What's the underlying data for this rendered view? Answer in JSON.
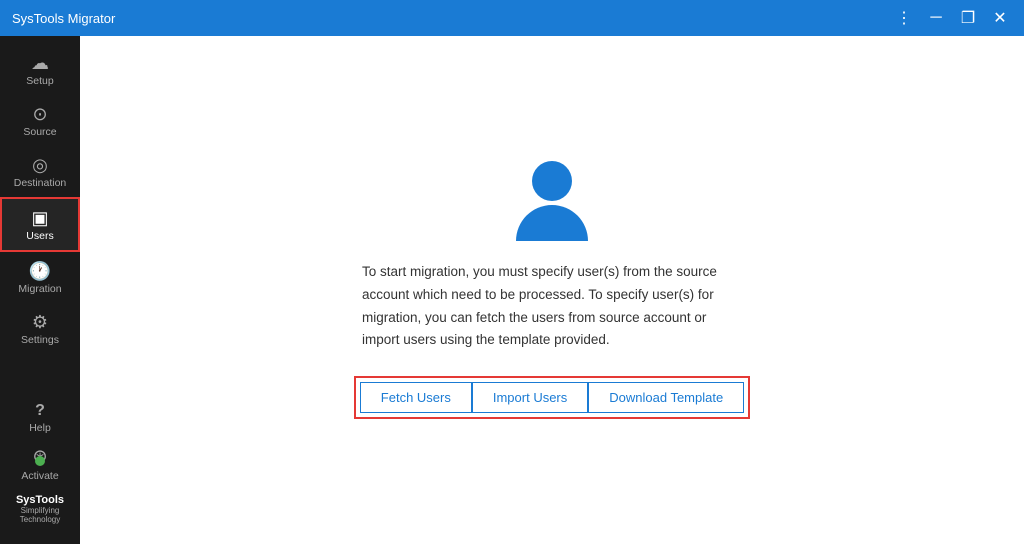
{
  "titleBar": {
    "title": "SysTools Migrator",
    "controls": [
      "menu",
      "minimize",
      "maximize",
      "close"
    ]
  },
  "sidebar": {
    "items": [
      {
        "id": "setup",
        "label": "Setup",
        "icon": "☁"
      },
      {
        "id": "source",
        "label": "Source",
        "icon": "⊙"
      },
      {
        "id": "destination",
        "label": "Destination",
        "icon": "◎"
      },
      {
        "id": "users",
        "label": "Users",
        "icon": "▣",
        "active": true
      },
      {
        "id": "migration",
        "label": "Migration",
        "icon": "🕐"
      },
      {
        "id": "settings",
        "label": "Settings",
        "icon": "⚙"
      }
    ],
    "help": {
      "icon": "?",
      "label": "Help"
    },
    "activate": {
      "label": "Activate"
    },
    "logo": {
      "text": "SysTools",
      "sub": "Simplifying Technology"
    }
  },
  "main": {
    "description": "To start migration, you must specify user(s) from the source account which need to be processed. To specify user(s) for migration, you can fetch the users from source account or import users using the template provided.",
    "buttons": [
      {
        "id": "fetch-users",
        "label": "Fetch Users"
      },
      {
        "id": "import-users",
        "label": "Import Users"
      },
      {
        "id": "download-template",
        "label": "Download Template"
      }
    ]
  }
}
